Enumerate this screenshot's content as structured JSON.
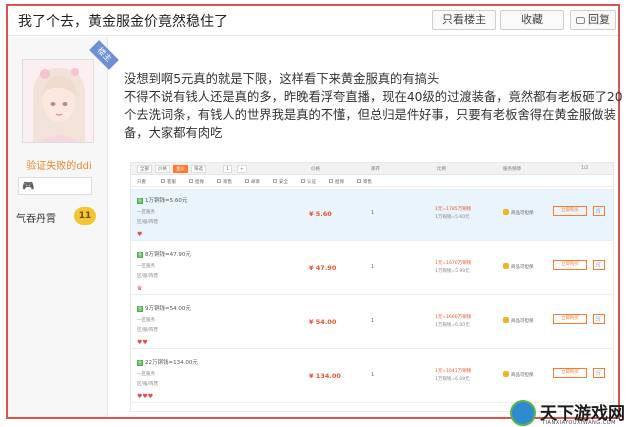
{
  "thread": {
    "title": "我了个去，黄金服金价竟然稳住了",
    "buttons": {
      "author_only": "只看楼主",
      "favorite": "收藏",
      "reply": "回复"
    }
  },
  "user": {
    "floor_tag": "楼主",
    "username": "验证失败的ddi",
    "level_name": "气吞丹霄",
    "level": "11"
  },
  "post": {
    "lines": [
      "没想到啊5元真的就是下限，这样看下来黄金服真的有搞头",
      "不得不说有钱人还是真的多，昨晚看浮夸直播，现在40级的过渡装备，竟然都有老板砸了20",
      "个去洗词条，有钱人的世界我是真的不懂，但总归是件好事，只要有老板舍得在黄金服做装",
      "备，大家都有肉吃"
    ]
  },
  "embedded": {
    "toolbar": {
      "items": [
        "全部",
        "价格",
        "金价",
        "筛选",
        "1",
        "+"
      ],
      "columns": [
        "价格",
        "库存",
        "比例",
        "服务保障"
      ],
      "page": "1/2"
    },
    "filters": [
      "只看",
      "客服",
      "担保",
      "寄售",
      "邮寄",
      "安全",
      "认证",
      "担保",
      "寄售"
    ],
    "rows": [
      {
        "tag": "急",
        "title": "1万铜钱=5.60元",
        "line1": "一区服务",
        "line2": "区/服/阵营",
        "price": "¥ 5.60",
        "qty": "1",
        "ratio1": "1元=1785万铜钱",
        "ratio2": "1万铜钱=5.60元",
        "safe": "商品可担保",
        "buy": "立即购买",
        "hearts": "♥",
        "highlight": true
      },
      {
        "tag": "急",
        "title": "8万铜钱=47.90元",
        "line1": "一区服务",
        "line2": "区/服/阵营",
        "price": "¥ 47.90",
        "qty": "1",
        "ratio1": "1元=1670万铜钱",
        "ratio2": "1万铜钱=5.99元",
        "safe": "商品可担保",
        "buy": "立即购买",
        "hearts": "♛",
        "highlight": false
      },
      {
        "tag": "急",
        "title": "9万铜钱=54.00元",
        "line1": "一区服务",
        "line2": "区/服/阵营",
        "price": "¥ 54.00",
        "qty": "1",
        "ratio1": "1元=1666万铜钱",
        "ratio2": "1万铜钱=6.00元",
        "safe": "商品可担保",
        "buy": "立即购买",
        "hearts": "♥♥",
        "highlight": false
      },
      {
        "tag": "急",
        "title": "22万铜钱=134.00元",
        "line1": "一区服务",
        "line2": "区/服/阵营",
        "price": "¥ 134.00",
        "qty": "1",
        "ratio1": "1元=1641万铜钱",
        "ratio2": "1万铜钱=6.09元",
        "safe": "商品可担保",
        "buy": "立即购买",
        "hearts": "♥♥♥",
        "highlight": false
      }
    ]
  },
  "watermark": {
    "title": "天下游戏网",
    "subtitle": "TIANXIAYOUXIWANG.COM"
  },
  "colors": {
    "frame_border": "#d9534f",
    "price": "#e8542e",
    "accent_orange": "#ff7a2f",
    "username": "#e8892e",
    "level_badge": "#f2c534"
  }
}
